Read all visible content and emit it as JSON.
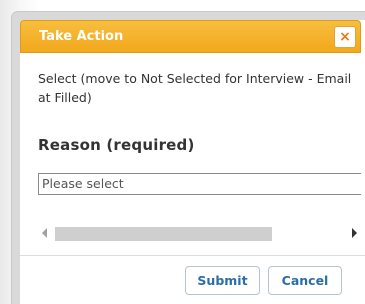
{
  "dialog": {
    "title": "Take Action",
    "close_icon": "close-icon",
    "close_glyph": "×",
    "instruction": "Select (move to Not Selected for Interview - Email at Filled)",
    "reason_label": "Reason (required)",
    "reason_select": {
      "selected_value": "Please select"
    },
    "buttons": {
      "submit": "Submit",
      "cancel": "Cancel"
    }
  },
  "colors": {
    "titlebar": "#f2a81c",
    "button_text": "#2b6ea7",
    "close_glyph": "#e87b11"
  }
}
